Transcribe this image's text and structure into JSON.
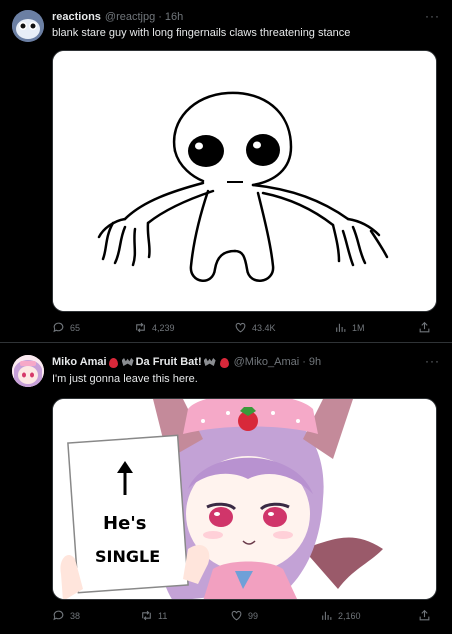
{
  "tweets": [
    {
      "display_name": "reactions",
      "handle": "@reactjpg",
      "time": "16h",
      "text": "blank stare guy with long fingernails claws threatening stance",
      "replies": "65",
      "retweets": "4,239",
      "likes": "43.4K",
      "views": "1M"
    },
    {
      "display_name": "Miko Amai",
      "display_name_suffix": "Da Fruit Bat!",
      "handle": "@Miko_Amai",
      "time": "9h",
      "text": "I'm just gonna leave this here.",
      "sign_line1": "He's",
      "sign_line2": "SINGLE",
      "replies": "38",
      "retweets": "11",
      "likes": "99",
      "views": "2,160"
    }
  ],
  "separator": "·",
  "more_icon": "more-horizontal-icon",
  "colors": {
    "background": "#000000",
    "muted": "#71767b",
    "text": "#e7e9ea",
    "divider": "#2f3336"
  }
}
